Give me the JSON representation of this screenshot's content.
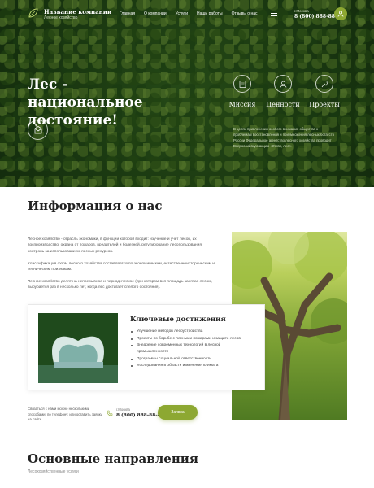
{
  "header": {
    "company_name": "Название компании",
    "company_sub": "Лесное хозяйство",
    "nav": [
      "Главная",
      "О компании",
      "Услуги",
      "Наши работы",
      "Отзывы о нас"
    ],
    "city": "г.Москва",
    "phone": "8 (800) 888-88-88"
  },
  "hero": {
    "title": "Лес - национальное достояние!",
    "features": [
      "Миссия",
      "Ценности",
      "Проекты"
    ],
    "text": "В целях привлечения особого внимания общества к проблемам восстановления и приумножения лесных богатств России Федеральное агентство лесного хозяйства проводит Всероссийскую акцию «Живи, лес!»"
  },
  "about": {
    "title": "Информация о нас",
    "paragraphs": [
      "Лесное хозяйство - отрасль экономики, в функции которой входит: изучение и учет лесов, их воспроизводство, охрана от пожаров, вредителей и болезней, регулирование лесопользования, контроль за использованием лесных ресурсов.",
      "Классификация форм лесного хозяйства составляется по экономическим, естественноисторическим и техническим признакам.",
      "Лесное хозяйство делят на непрерывное и периодическое (при котором вся площадь занятая лесом, вырубается раз в несколько лет, когда лес достигает спелого состояния)."
    ]
  },
  "achievements": {
    "title": "Ключевые достижения",
    "items": [
      "Улучшение методов лесоустройства",
      "Проекты по борьбе с лесными пожарами и защите лесов",
      "Внедрение современных технологий в лесной промышленности",
      "Программы социальной ответственности",
      "Исследования в области изменения климата"
    ]
  },
  "contact": {
    "note": "Связаться с нами можно несколькими способами: по телефону, или оставить заявку на сайте",
    "city": "г.Москва",
    "phone": "8 (800) 888-88-88",
    "button": "Заявка"
  },
  "directions": {
    "title": "Основные направления",
    "subtitle": "Лесохозяйственные услуги"
  },
  "colors": {
    "accent": "#8da832",
    "forest_dark": "#1e4214"
  }
}
